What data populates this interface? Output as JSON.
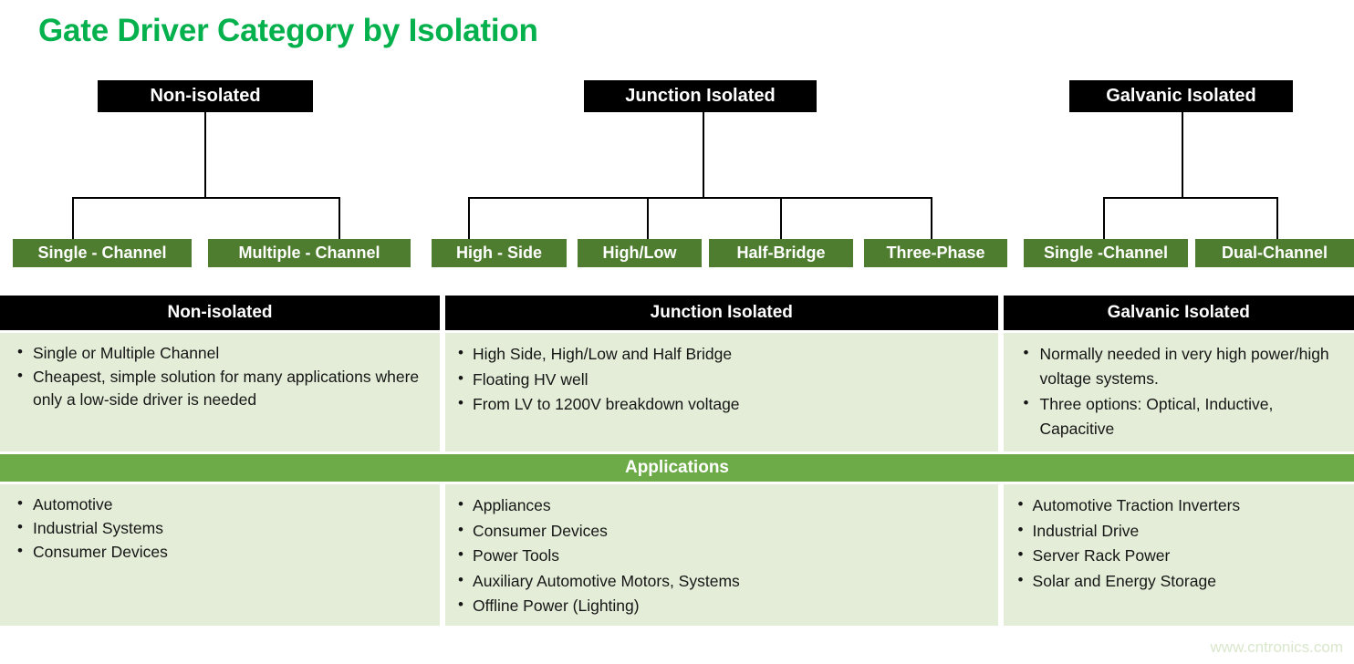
{
  "title": "Gate Driver Category by Isolation",
  "brand": {
    "title_green": "#04b14c",
    "box_green": "#4f7d2f",
    "apps_green": "#6cab47",
    "cell_bg": "#e3edd7",
    "header_black": "#000000"
  },
  "tree": {
    "groups": [
      {
        "parent": "Non-isolated",
        "children": [
          "Single - Channel",
          "Multiple - Channel"
        ]
      },
      {
        "parent": "Junction Isolated",
        "children": [
          "High - Side",
          "High/Low",
          "Half-Bridge",
          "Three-Phase"
        ]
      },
      {
        "parent": "Galvanic Isolated",
        "children": [
          "Single -Channel",
          "Dual-Channel"
        ]
      }
    ]
  },
  "matrix": {
    "headers": [
      "Non-isolated",
      "Junction Isolated",
      "Galvanic Isolated"
    ],
    "features": [
      [
        "Single or Multiple Channel",
        "Cheapest, simple solution for many applications where only a low-side driver is needed"
      ],
      [
        "High Side, High/Low and Half Bridge",
        "Floating HV well",
        "From LV to 1200V breakdown voltage"
      ],
      [
        "Normally needed in very high power/high voltage systems.",
        "Three options: Optical, Inductive, Capacitive"
      ]
    ],
    "applications_label": "Applications",
    "applications": [
      [
        "Automotive",
        "Industrial Systems",
        "Consumer Devices"
      ],
      [
        "Appliances",
        "Consumer Devices",
        "Power Tools",
        "Auxiliary Automotive Motors, Systems",
        "Offline Power (Lighting)"
      ],
      [
        "Automotive Traction Inverters",
        "Industrial Drive",
        "Server Rack Power",
        "Solar and Energy Storage"
      ]
    ]
  },
  "footer": {
    "watermark": "www.cntronics.com"
  }
}
